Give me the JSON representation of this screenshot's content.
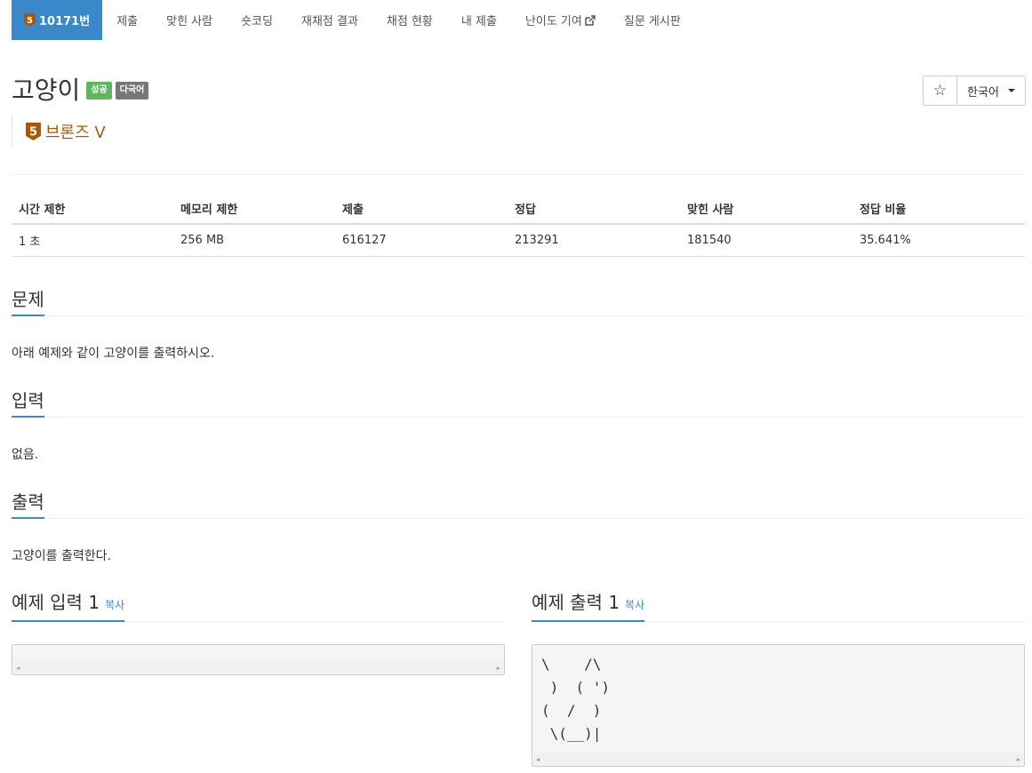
{
  "nav": {
    "problem_number": "10171번",
    "items": [
      "제출",
      "맞힌 사람",
      "숏코딩",
      "재채점 결과",
      "채점 현황",
      "내 제출",
      "난이도 기여",
      "질문 게시판"
    ]
  },
  "tier": {
    "number": "5",
    "name": "브론즈 V",
    "color": "#ad5600"
  },
  "problem": {
    "title": "고양이",
    "labels": {
      "success": "성공",
      "multi_lang": "다국어"
    }
  },
  "toolbar": {
    "star": "☆",
    "language": "한국어"
  },
  "stats": {
    "headers": [
      "시간 제한",
      "메모리 제한",
      "제출",
      "정답",
      "맞힌 사람",
      "정답 비율"
    ],
    "values": [
      "1 초",
      "256 MB",
      "616127",
      "213291",
      "181540",
      "35.641%"
    ]
  },
  "sections": {
    "problem": {
      "title": "문제",
      "text": "아래 예제와 같이 고양이를 출력하시오."
    },
    "input": {
      "title": "입력",
      "text": "없음."
    },
    "output": {
      "title": "출력",
      "text": "고양이를 출력한다."
    }
  },
  "samples": {
    "input_title": "예제 입력 1",
    "output_title": "예제 출력 1",
    "copy_label": "복사",
    "input_value": "",
    "output_value": "\\    /\\\n )  ( ')\n(  /  )\n \\(__)|"
  },
  "colors": {
    "accent": "#3a87c9",
    "success": "#5cb85c",
    "multi": "#777777",
    "bronze": "#ad5600"
  }
}
